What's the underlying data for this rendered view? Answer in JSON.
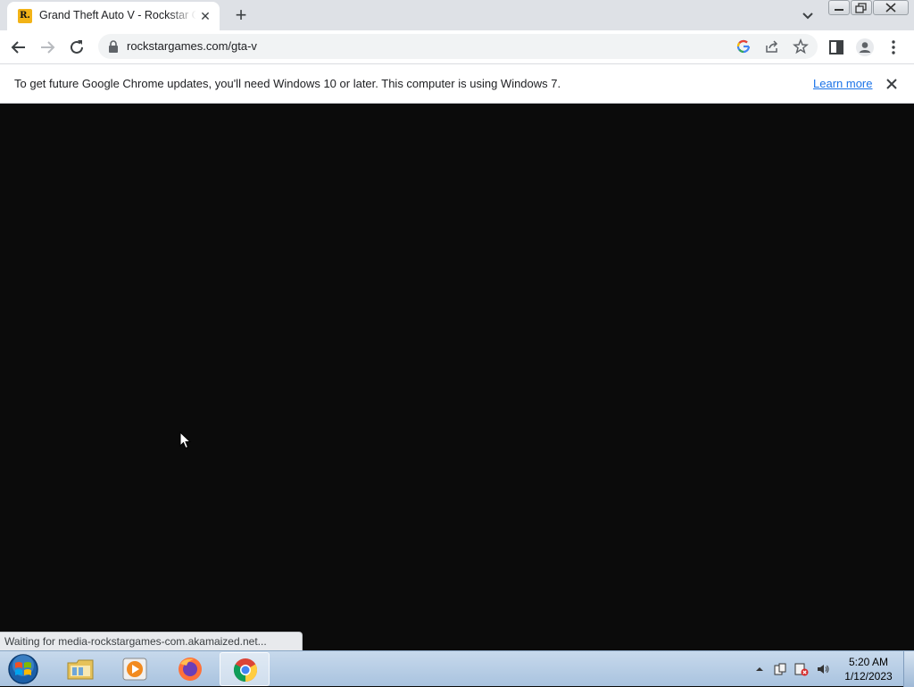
{
  "browser": {
    "tab": {
      "title": "Grand Theft Auto V - Rockstar Games",
      "favicon_letter": "R."
    },
    "address_bar": {
      "url": "rockstargames.com/gta-v"
    },
    "infobar": {
      "message": "To get future Google Chrome updates, you'll need Windows 10 or later. This computer is using Windows 7.",
      "link_label": "Learn more"
    },
    "status_bubble": "Waiting for media-rockstargames-com.akamaized.net..."
  },
  "taskbar": {
    "apps": [
      "windows-explorer",
      "media-player",
      "firefox",
      "chrome"
    ],
    "active_app": "chrome",
    "clock": {
      "time": "5:20 AM",
      "date": "1/12/2023"
    }
  },
  "colors": {
    "page_background": "#0b0b0b",
    "tab_strip": "#dee1e6",
    "link": "#1a73e8",
    "favicon": "#f2b317"
  }
}
